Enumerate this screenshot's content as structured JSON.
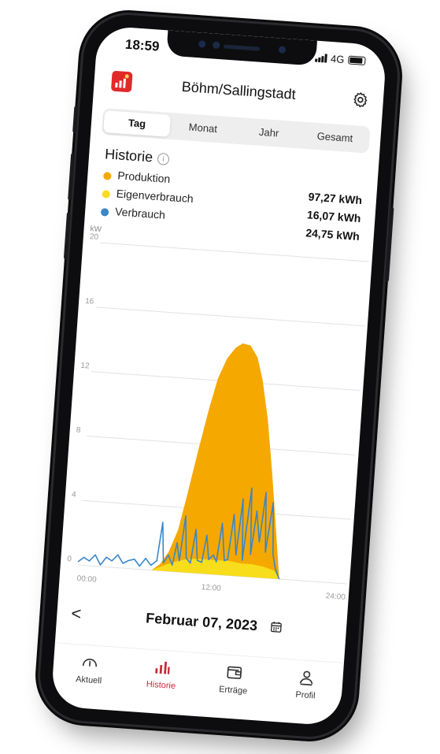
{
  "status_bar": {
    "time": "18:59",
    "network": "4G"
  },
  "header": {
    "title": "Böhm/Sallingstadt"
  },
  "period_tabs": [
    {
      "label": "Tag",
      "active": true
    },
    {
      "label": "Monat",
      "active": false
    },
    {
      "label": "Jahr",
      "active": false
    },
    {
      "label": "Gesamt",
      "active": false
    }
  ],
  "history": {
    "title": "Historie",
    "legend": [
      {
        "label": "Produktion",
        "value": "97,27 kWh",
        "color": "#f5a800"
      },
      {
        "label": "Eigenverbrauch",
        "value": "16,07 kWh",
        "color": "#f7dd1b"
      },
      {
        "label": "Verbrauch",
        "value": "24,75 kWh",
        "color": "#3a86c8"
      }
    ]
  },
  "chart_data": {
    "type": "area",
    "ylabel": "kW",
    "ylim": [
      0,
      20
    ],
    "y_ticks": [
      "0",
      "4",
      "8",
      "12",
      "16",
      "20"
    ],
    "x_ticks": [
      "00:00",
      "12:00",
      "24:00"
    ],
    "xlim_hours": [
      0,
      24
    ],
    "grid": true,
    "series": [
      {
        "name": "Produktion",
        "type": "area",
        "color": "#f5a800",
        "x": [
          0,
          6.6,
          7.3,
          8.0,
          8.7,
          9.3,
          10.0,
          10.7,
          11.3,
          12.0,
          12.7,
          13.3,
          14.0,
          14.7,
          15.3,
          16.0,
          16.7,
          17.3,
          18.0,
          24
        ],
        "y": [
          0,
          0,
          0.4,
          1.2,
          2.6,
          4.8,
          7.6,
          10.2,
          12.1,
          13.4,
          14.1,
          14.4,
          14.3,
          13.6,
          12.2,
          9.8,
          6.6,
          3.6,
          0,
          0
        ]
      },
      {
        "name": "Eigenverbrauch",
        "type": "area",
        "color": "#f7dd1b",
        "x": [
          0,
          6.6,
          7.5,
          8.5,
          9.5,
          10.5,
          11.5,
          12.5,
          13.5,
          14.5,
          15.5,
          16.5,
          17.5,
          18.0,
          24
        ],
        "y": [
          0,
          0,
          0.3,
          0.6,
          0.8,
          0.9,
          0.9,
          0.9,
          0.9,
          0.8,
          0.8,
          0.7,
          0.5,
          0,
          0
        ]
      },
      {
        "name": "Verbrauch",
        "type": "line",
        "color": "#3a86c8",
        "x": [
          0,
          0.5,
          1.0,
          1.5,
          2.0,
          2.5,
          3.0,
          3.5,
          4.0,
          4.5,
          5.0,
          5.5,
          6.0,
          6.5,
          7.0,
          7.3,
          7.6,
          8.0,
          8.4,
          8.7,
          9.0,
          9.3,
          9.6,
          10.0,
          10.3,
          10.6,
          11.0,
          11.3,
          11.6,
          12.0,
          12.3,
          12.6,
          13.0,
          13.3,
          13.6,
          14.0,
          14.3,
          14.6,
          15.0,
          15.3,
          15.6,
          16.0,
          16.3,
          16.6,
          17.0,
          17.3,
          17.6,
          18.0
        ],
        "y": [
          0.2,
          0.5,
          0.3,
          0.7,
          0.1,
          0.6,
          0.4,
          0.8,
          0.3,
          0.5,
          0.6,
          0.2,
          0.7,
          0.3,
          0.6,
          3.0,
          0.5,
          1.0,
          0.4,
          1.8,
          0.7,
          3.5,
          0.9,
          0.6,
          2.7,
          0.8,
          0.7,
          2.4,
          0.9,
          1.2,
          0.8,
          3.2,
          0.9,
          1.0,
          3.8,
          1.3,
          4.8,
          1.0,
          5.5,
          1.4,
          4.1,
          2.2,
          5.3,
          1.6,
          4.7,
          1.5,
          0.6,
          0.0
        ]
      }
    ]
  },
  "date_nav": {
    "back_glyph": "<",
    "date_label": "Februar 07, 2023"
  },
  "bottom_nav": [
    {
      "label": "Aktuell",
      "icon": "gauge-icon",
      "active": false
    },
    {
      "label": "Historie",
      "icon": "bar-chart-icon",
      "active": true
    },
    {
      "label": "Erträge",
      "icon": "wallet-icon",
      "active": false
    },
    {
      "label": "Profil",
      "icon": "profile-icon",
      "active": false
    }
  ]
}
